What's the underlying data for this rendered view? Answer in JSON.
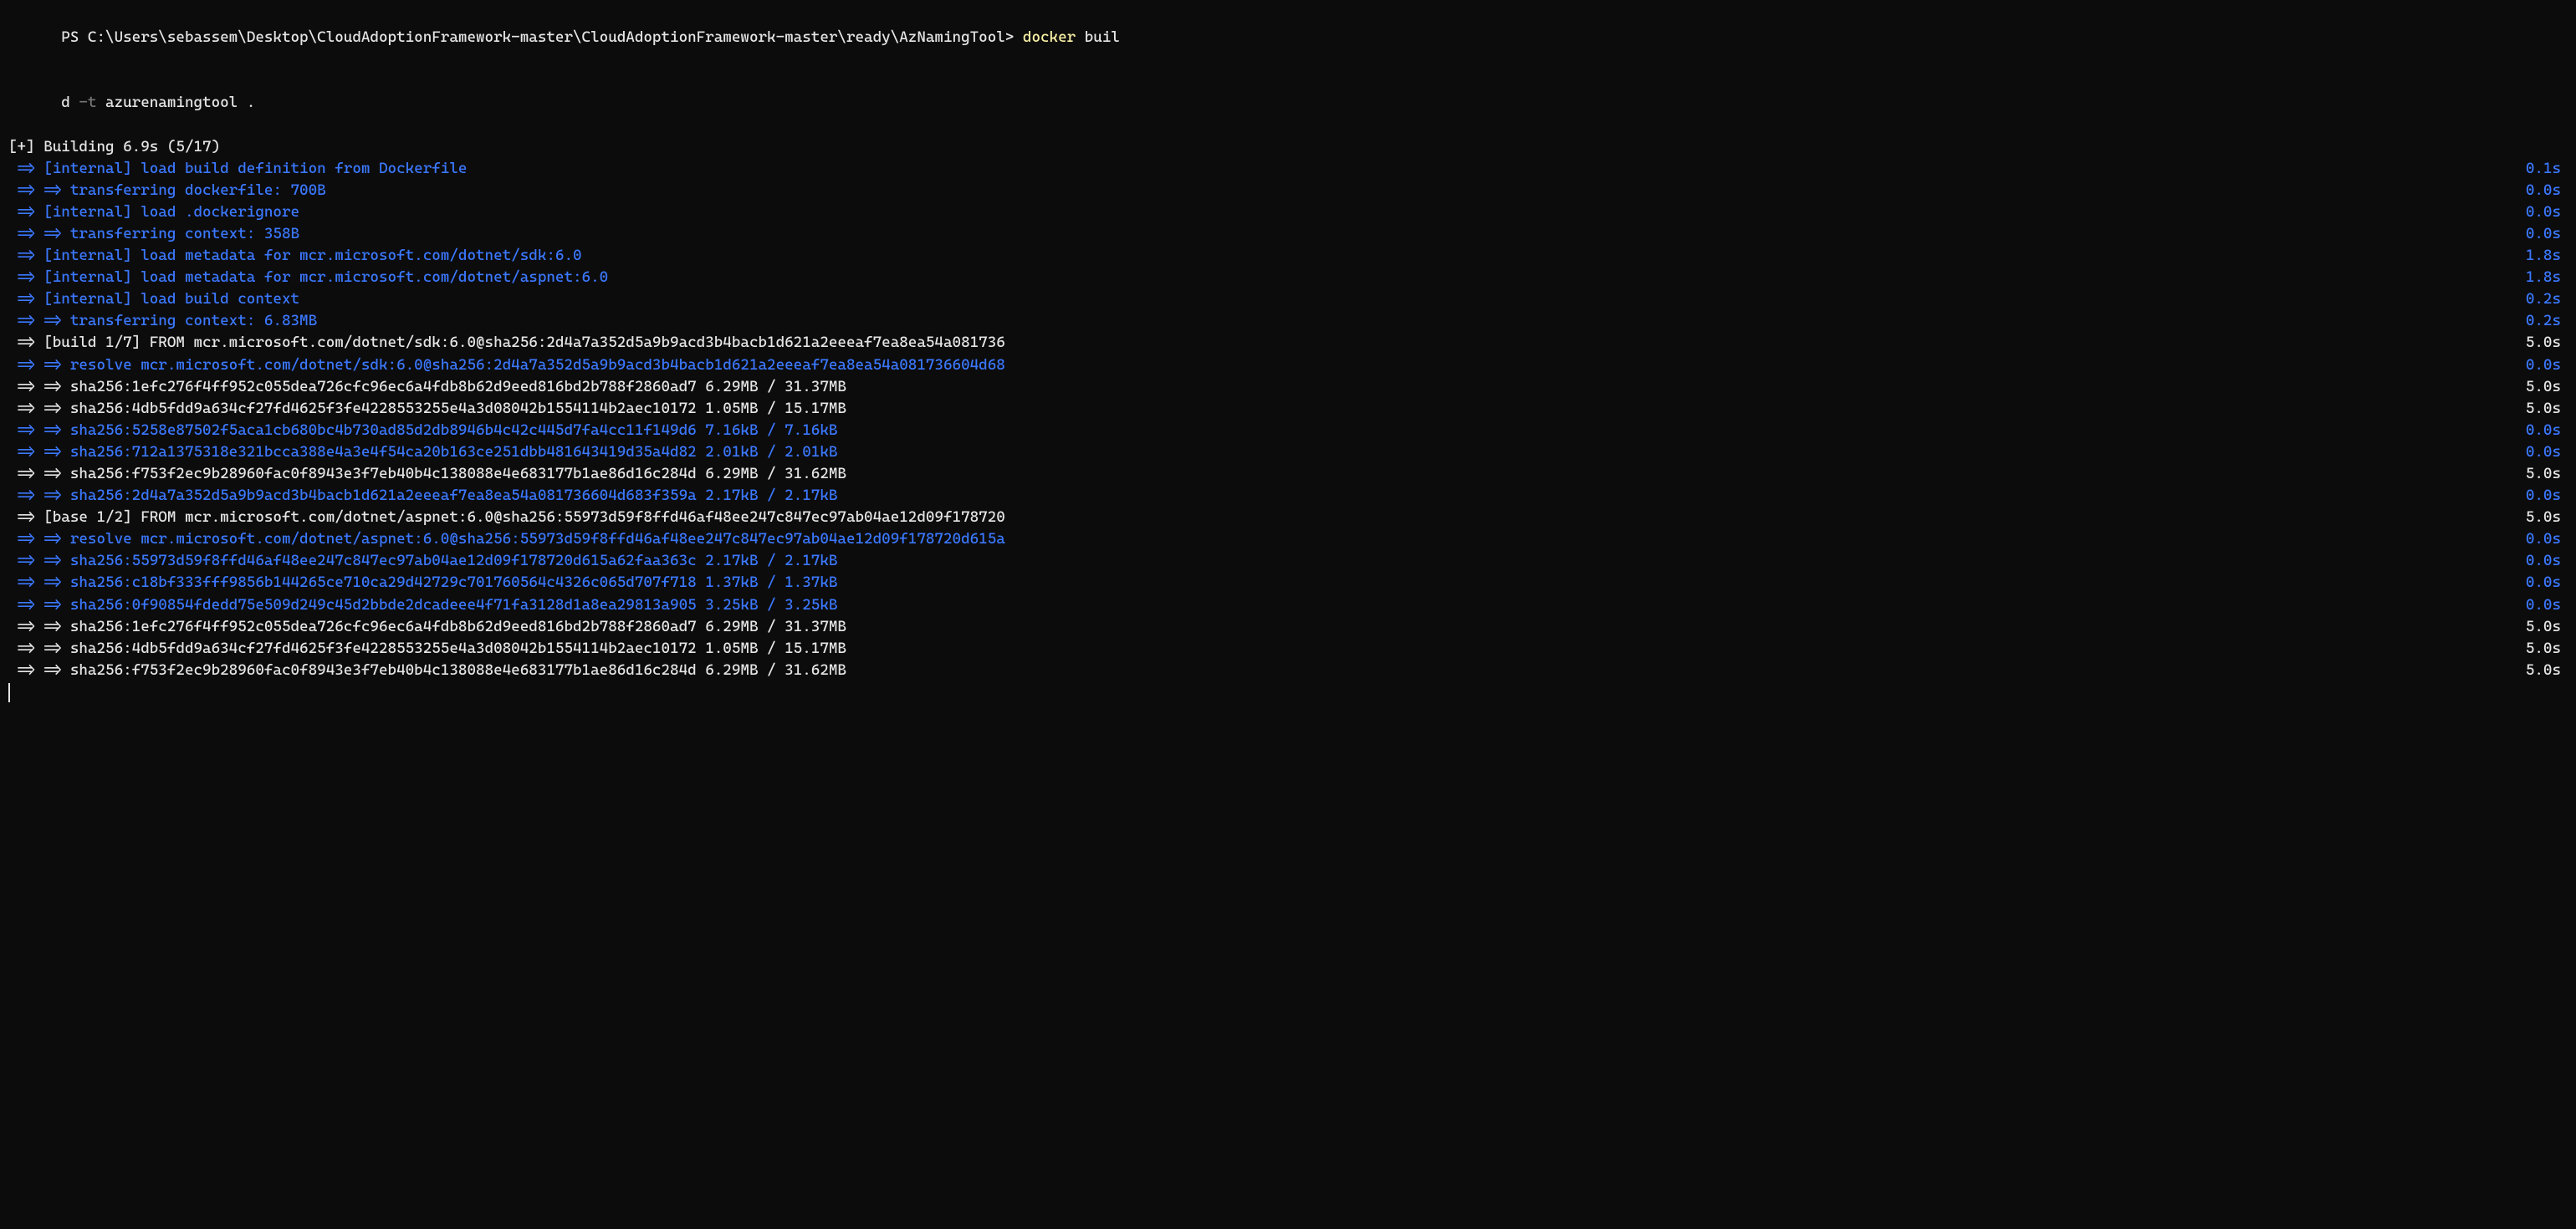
{
  "prompt": {
    "ps_prefix": "PS ",
    "path": "C:\\Users\\sebassem\\Desktop\\CloudAdoptionFramework-master\\CloudAdoptionFramework-master\\ready\\AzNamingTool",
    "suffix": "> ",
    "cmd1": "docker",
    "cmd2": " buil",
    "cmd3": "d ",
    "flag": "-t",
    "args": " azurenamingtool ."
  },
  "building": "[+] Building 6.9s (5/17)",
  "rows": [
    {
      "left": " => [internal] load build definition from Dockerfile",
      "right": "0.1s",
      "class": "blue"
    },
    {
      "left": " => => transferring dockerfile: 700B",
      "right": "0.0s",
      "class": "blue"
    },
    {
      "left": " => [internal] load .dockerignore",
      "right": "0.0s",
      "class": "blue"
    },
    {
      "left": " => => transferring context: 358B",
      "right": "0.0s",
      "class": "blue"
    },
    {
      "left": " => [internal] load metadata for mcr.microsoft.com/dotnet/sdk:6.0",
      "right": "1.8s",
      "class": "blue"
    },
    {
      "left": " => [internal] load metadata for mcr.microsoft.com/dotnet/aspnet:6.0",
      "right": "1.8s",
      "class": "blue"
    },
    {
      "left": " => [internal] load build context",
      "right": "0.2s",
      "class": "blue"
    },
    {
      "left": " => => transferring context: 6.83MB",
      "right": "0.2s",
      "class": "blue"
    },
    {
      "left": " => [build 1/7] FROM mcr.microsoft.com/dotnet/sdk:6.0@sha256:2d4a7a352d5a9b9acd3b4bacb1d621a2eeeaf7ea8ea54a081736",
      "right": "5.0s",
      "class": "white"
    },
    {
      "left": " => => resolve mcr.microsoft.com/dotnet/sdk:6.0@sha256:2d4a7a352d5a9b9acd3b4bacb1d621a2eeeaf7ea8ea54a081736604d68",
      "right": "0.0s",
      "class": "blue"
    },
    {
      "left": " => => sha256:1efc276f4ff952c055dea726cfc96ec6a4fdb8b62d9eed816bd2b788f2860ad7 6.29MB / 31.37MB",
      "right": "5.0s",
      "class": "white"
    },
    {
      "left": " => => sha256:4db5fdd9a634cf27fd4625f3fe4228553255e4a3d08042b1554114b2aec10172 1.05MB / 15.17MB",
      "right": "5.0s",
      "class": "white"
    },
    {
      "left": " => => sha256:5258e87502f5aca1cb680bc4b730ad85d2db8946b4c42c445d7fa4cc11f149d6 7.16kB / 7.16kB",
      "right": "0.0s",
      "class": "blue"
    },
    {
      "left": " => => sha256:712a1375318e321bcca388e4a3e4f54ca20b163ce251dbb481643419d35a4d82 2.01kB / 2.01kB",
      "right": "0.0s",
      "class": "blue"
    },
    {
      "left": " => => sha256:f753f2ec9b28960fac0f8943e3f7eb40b4c138088e4e683177b1ae86d16c284d 6.29MB / 31.62MB",
      "right": "5.0s",
      "class": "white"
    },
    {
      "left": " => => sha256:2d4a7a352d5a9b9acd3b4bacb1d621a2eeeaf7ea8ea54a081736604d683f359a 2.17kB / 2.17kB",
      "right": "0.0s",
      "class": "blue"
    },
    {
      "left": " => [base 1/2] FROM mcr.microsoft.com/dotnet/aspnet:6.0@sha256:55973d59f8ffd46af48ee247c847ec97ab04ae12d09f178720",
      "right": "5.0s",
      "class": "white"
    },
    {
      "left": " => => resolve mcr.microsoft.com/dotnet/aspnet:6.0@sha256:55973d59f8ffd46af48ee247c847ec97ab04ae12d09f178720d615a",
      "right": "0.0s",
      "class": "blue"
    },
    {
      "left": " => => sha256:55973d59f8ffd46af48ee247c847ec97ab04ae12d09f178720d615a62faa363c 2.17kB / 2.17kB",
      "right": "0.0s",
      "class": "blue"
    },
    {
      "left": " => => sha256:c18bf333fff9856b144265ce710ca29d42729c701760564c4326c065d707f718 1.37kB / 1.37kB",
      "right": "0.0s",
      "class": "blue"
    },
    {
      "left": " => => sha256:0f90854fdedd75e509d249c45d2bbde2dcadeee4f71fa3128d1a8ea29813a905 3.25kB / 3.25kB",
      "right": "0.0s",
      "class": "blue"
    },
    {
      "left": " => => sha256:1efc276f4ff952c055dea726cfc96ec6a4fdb8b62d9eed816bd2b788f2860ad7 6.29MB / 31.37MB",
      "right": "5.0s",
      "class": "white"
    },
    {
      "left": " => => sha256:4db5fdd9a634cf27fd4625f3fe4228553255e4a3d08042b1554114b2aec10172 1.05MB / 15.17MB",
      "right": "5.0s",
      "class": "white"
    },
    {
      "left": " => => sha256:f753f2ec9b28960fac0f8943e3f7eb40b4c138088e4e683177b1ae86d16c284d 6.29MB / 31.62MB",
      "right": "5.0s",
      "class": "white"
    }
  ]
}
